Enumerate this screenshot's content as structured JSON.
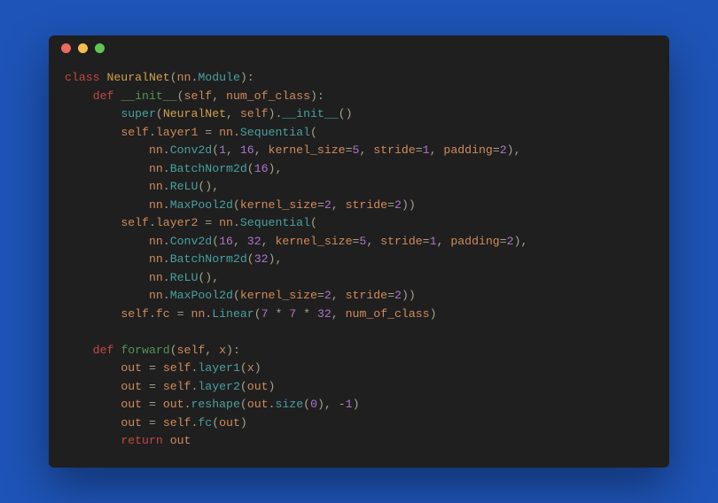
{
  "colors": {
    "bg_page": "#1e54b7",
    "bg_window": "#1f1f1f",
    "traffic_red": "#ec6a5e",
    "traffic_yellow": "#f3bd4f",
    "traffic_green": "#61c554",
    "kw": "#c74646",
    "defn": "#529554",
    "classname": "#d1a14c",
    "call": "#4aa0a0",
    "num": "#b074c9",
    "ident": "#d18b5a",
    "punct": "#a6a28c",
    "plain": "#cfd0c6"
  },
  "code": {
    "lines": [
      [
        {
          "t": "class ",
          "c": "kw"
        },
        {
          "t": "NeuralNet",
          "c": "cls"
        },
        {
          "t": "(",
          "c": "pun"
        },
        {
          "t": "nn",
          "c": "idnt"
        },
        {
          "t": ".",
          "c": "pun"
        },
        {
          "t": "Module",
          "c": "call"
        },
        {
          "t": "):",
          "c": "pun"
        }
      ],
      [
        {
          "t": "    ",
          "c": "plain"
        },
        {
          "t": "def ",
          "c": "kw"
        },
        {
          "t": "__init__",
          "c": "defn"
        },
        {
          "t": "(",
          "c": "pun"
        },
        {
          "t": "self",
          "c": "idnt"
        },
        {
          "t": ", ",
          "c": "pun"
        },
        {
          "t": "num_of_class",
          "c": "idnt"
        },
        {
          "t": "):",
          "c": "pun"
        }
      ],
      [
        {
          "t": "        ",
          "c": "plain"
        },
        {
          "t": "super",
          "c": "call"
        },
        {
          "t": "(",
          "c": "pun"
        },
        {
          "t": "NeuralNet",
          "c": "cls"
        },
        {
          "t": ", ",
          "c": "pun"
        },
        {
          "t": "self",
          "c": "idnt"
        },
        {
          "t": ").",
          "c": "pun"
        },
        {
          "t": "__init__",
          "c": "call"
        },
        {
          "t": "()",
          "c": "pun"
        }
      ],
      [
        {
          "t": "        ",
          "c": "plain"
        },
        {
          "t": "self",
          "c": "idnt"
        },
        {
          "t": ".",
          "c": "pun"
        },
        {
          "t": "layer1",
          "c": "idnt"
        },
        {
          "t": " = ",
          "c": "pun"
        },
        {
          "t": "nn",
          "c": "idnt"
        },
        {
          "t": ".",
          "c": "pun"
        },
        {
          "t": "Sequential",
          "c": "call"
        },
        {
          "t": "(",
          "c": "pun"
        }
      ],
      [
        {
          "t": "            ",
          "c": "plain"
        },
        {
          "t": "nn",
          "c": "idnt"
        },
        {
          "t": ".",
          "c": "pun"
        },
        {
          "t": "Conv2d",
          "c": "call"
        },
        {
          "t": "(",
          "c": "pun"
        },
        {
          "t": "1",
          "c": "num"
        },
        {
          "t": ", ",
          "c": "pun"
        },
        {
          "t": "16",
          "c": "num"
        },
        {
          "t": ", ",
          "c": "pun"
        },
        {
          "t": "kernel_size",
          "c": "arg"
        },
        {
          "t": "=",
          "c": "pun"
        },
        {
          "t": "5",
          "c": "num"
        },
        {
          "t": ", ",
          "c": "pun"
        },
        {
          "t": "stride",
          "c": "arg"
        },
        {
          "t": "=",
          "c": "pun"
        },
        {
          "t": "1",
          "c": "num"
        },
        {
          "t": ", ",
          "c": "pun"
        },
        {
          "t": "padding",
          "c": "arg"
        },
        {
          "t": "=",
          "c": "pun"
        },
        {
          "t": "2",
          "c": "num"
        },
        {
          "t": "),",
          "c": "pun"
        }
      ],
      [
        {
          "t": "            ",
          "c": "plain"
        },
        {
          "t": "nn",
          "c": "idnt"
        },
        {
          "t": ".",
          "c": "pun"
        },
        {
          "t": "BatchNorm2d",
          "c": "call"
        },
        {
          "t": "(",
          "c": "pun"
        },
        {
          "t": "16",
          "c": "num"
        },
        {
          "t": "),",
          "c": "pun"
        }
      ],
      [
        {
          "t": "            ",
          "c": "plain"
        },
        {
          "t": "nn",
          "c": "idnt"
        },
        {
          "t": ".",
          "c": "pun"
        },
        {
          "t": "ReLU",
          "c": "call"
        },
        {
          "t": "(),",
          "c": "pun"
        }
      ],
      [
        {
          "t": "            ",
          "c": "plain"
        },
        {
          "t": "nn",
          "c": "idnt"
        },
        {
          "t": ".",
          "c": "pun"
        },
        {
          "t": "MaxPool2d",
          "c": "call"
        },
        {
          "t": "(",
          "c": "pun"
        },
        {
          "t": "kernel_size",
          "c": "arg"
        },
        {
          "t": "=",
          "c": "pun"
        },
        {
          "t": "2",
          "c": "num"
        },
        {
          "t": ", ",
          "c": "pun"
        },
        {
          "t": "stride",
          "c": "arg"
        },
        {
          "t": "=",
          "c": "pun"
        },
        {
          "t": "2",
          "c": "num"
        },
        {
          "t": "))",
          "c": "pun"
        }
      ],
      [
        {
          "t": "        ",
          "c": "plain"
        },
        {
          "t": "self",
          "c": "idnt"
        },
        {
          "t": ".",
          "c": "pun"
        },
        {
          "t": "layer2",
          "c": "idnt"
        },
        {
          "t": " = ",
          "c": "pun"
        },
        {
          "t": "nn",
          "c": "idnt"
        },
        {
          "t": ".",
          "c": "pun"
        },
        {
          "t": "Sequential",
          "c": "call"
        },
        {
          "t": "(",
          "c": "pun"
        }
      ],
      [
        {
          "t": "            ",
          "c": "plain"
        },
        {
          "t": "nn",
          "c": "idnt"
        },
        {
          "t": ".",
          "c": "pun"
        },
        {
          "t": "Conv2d",
          "c": "call"
        },
        {
          "t": "(",
          "c": "pun"
        },
        {
          "t": "16",
          "c": "num"
        },
        {
          "t": ", ",
          "c": "pun"
        },
        {
          "t": "32",
          "c": "num"
        },
        {
          "t": ", ",
          "c": "pun"
        },
        {
          "t": "kernel_size",
          "c": "arg"
        },
        {
          "t": "=",
          "c": "pun"
        },
        {
          "t": "5",
          "c": "num"
        },
        {
          "t": ", ",
          "c": "pun"
        },
        {
          "t": "stride",
          "c": "arg"
        },
        {
          "t": "=",
          "c": "pun"
        },
        {
          "t": "1",
          "c": "num"
        },
        {
          "t": ", ",
          "c": "pun"
        },
        {
          "t": "padding",
          "c": "arg"
        },
        {
          "t": "=",
          "c": "pun"
        },
        {
          "t": "2",
          "c": "num"
        },
        {
          "t": "),",
          "c": "pun"
        }
      ],
      [
        {
          "t": "            ",
          "c": "plain"
        },
        {
          "t": "nn",
          "c": "idnt"
        },
        {
          "t": ".",
          "c": "pun"
        },
        {
          "t": "BatchNorm2d",
          "c": "call"
        },
        {
          "t": "(",
          "c": "pun"
        },
        {
          "t": "32",
          "c": "num"
        },
        {
          "t": "),",
          "c": "pun"
        }
      ],
      [
        {
          "t": "            ",
          "c": "plain"
        },
        {
          "t": "nn",
          "c": "idnt"
        },
        {
          "t": ".",
          "c": "pun"
        },
        {
          "t": "ReLU",
          "c": "call"
        },
        {
          "t": "(),",
          "c": "pun"
        }
      ],
      [
        {
          "t": "            ",
          "c": "plain"
        },
        {
          "t": "nn",
          "c": "idnt"
        },
        {
          "t": ".",
          "c": "pun"
        },
        {
          "t": "MaxPool2d",
          "c": "call"
        },
        {
          "t": "(",
          "c": "pun"
        },
        {
          "t": "kernel_size",
          "c": "arg"
        },
        {
          "t": "=",
          "c": "pun"
        },
        {
          "t": "2",
          "c": "num"
        },
        {
          "t": ", ",
          "c": "pun"
        },
        {
          "t": "stride",
          "c": "arg"
        },
        {
          "t": "=",
          "c": "pun"
        },
        {
          "t": "2",
          "c": "num"
        },
        {
          "t": "))",
          "c": "pun"
        }
      ],
      [
        {
          "t": "        ",
          "c": "plain"
        },
        {
          "t": "self",
          "c": "idnt"
        },
        {
          "t": ".",
          "c": "pun"
        },
        {
          "t": "fc",
          "c": "idnt"
        },
        {
          "t": " = ",
          "c": "pun"
        },
        {
          "t": "nn",
          "c": "idnt"
        },
        {
          "t": ".",
          "c": "pun"
        },
        {
          "t": "Linear",
          "c": "call"
        },
        {
          "t": "(",
          "c": "pun"
        },
        {
          "t": "7",
          "c": "num"
        },
        {
          "t": " * ",
          "c": "pun"
        },
        {
          "t": "7",
          "c": "num"
        },
        {
          "t": " * ",
          "c": "pun"
        },
        {
          "t": "32",
          "c": "num"
        },
        {
          "t": ", ",
          "c": "pun"
        },
        {
          "t": "num_of_class",
          "c": "idnt"
        },
        {
          "t": ")",
          "c": "pun"
        }
      ],
      [
        {
          "t": "",
          "c": "plain"
        }
      ],
      [
        {
          "t": "    ",
          "c": "plain"
        },
        {
          "t": "def ",
          "c": "kw"
        },
        {
          "t": "forward",
          "c": "defn"
        },
        {
          "t": "(",
          "c": "pun"
        },
        {
          "t": "self",
          "c": "idnt"
        },
        {
          "t": ", ",
          "c": "pun"
        },
        {
          "t": "x",
          "c": "idnt"
        },
        {
          "t": "):",
          "c": "pun"
        }
      ],
      [
        {
          "t": "        ",
          "c": "plain"
        },
        {
          "t": "out",
          "c": "idnt"
        },
        {
          "t": " = ",
          "c": "pun"
        },
        {
          "t": "self",
          "c": "idnt"
        },
        {
          "t": ".",
          "c": "pun"
        },
        {
          "t": "layer1",
          "c": "call"
        },
        {
          "t": "(",
          "c": "pun"
        },
        {
          "t": "x",
          "c": "idnt"
        },
        {
          "t": ")",
          "c": "pun"
        }
      ],
      [
        {
          "t": "        ",
          "c": "plain"
        },
        {
          "t": "out",
          "c": "idnt"
        },
        {
          "t": " = ",
          "c": "pun"
        },
        {
          "t": "self",
          "c": "idnt"
        },
        {
          "t": ".",
          "c": "pun"
        },
        {
          "t": "layer2",
          "c": "call"
        },
        {
          "t": "(",
          "c": "pun"
        },
        {
          "t": "out",
          "c": "idnt"
        },
        {
          "t": ")",
          "c": "pun"
        }
      ],
      [
        {
          "t": "        ",
          "c": "plain"
        },
        {
          "t": "out",
          "c": "idnt"
        },
        {
          "t": " = ",
          "c": "pun"
        },
        {
          "t": "out",
          "c": "idnt"
        },
        {
          "t": ".",
          "c": "pun"
        },
        {
          "t": "reshape",
          "c": "call"
        },
        {
          "t": "(",
          "c": "pun"
        },
        {
          "t": "out",
          "c": "idnt"
        },
        {
          "t": ".",
          "c": "pun"
        },
        {
          "t": "size",
          "c": "call"
        },
        {
          "t": "(",
          "c": "pun"
        },
        {
          "t": "0",
          "c": "num"
        },
        {
          "t": "), ",
          "c": "pun"
        },
        {
          "t": "-",
          "c": "pun"
        },
        {
          "t": "1",
          "c": "num"
        },
        {
          "t": ")",
          "c": "pun"
        }
      ],
      [
        {
          "t": "        ",
          "c": "plain"
        },
        {
          "t": "out",
          "c": "idnt"
        },
        {
          "t": " = ",
          "c": "pun"
        },
        {
          "t": "self",
          "c": "idnt"
        },
        {
          "t": ".",
          "c": "pun"
        },
        {
          "t": "fc",
          "c": "call"
        },
        {
          "t": "(",
          "c": "pun"
        },
        {
          "t": "out",
          "c": "idnt"
        },
        {
          "t": ")",
          "c": "pun"
        }
      ],
      [
        {
          "t": "        ",
          "c": "plain"
        },
        {
          "t": "return ",
          "c": "kw"
        },
        {
          "t": "out",
          "c": "idnt"
        }
      ]
    ]
  }
}
